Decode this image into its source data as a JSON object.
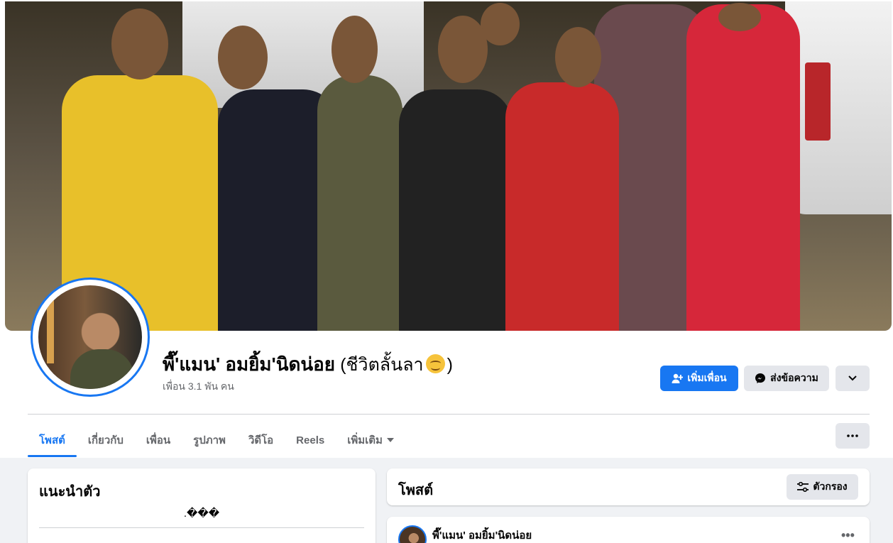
{
  "profile": {
    "name": "พี๊'แมน' อมยิ้ม'นิดน่อย",
    "alt_name_open": "(ชีวิตลั้นลา",
    "alt_name_close": ")",
    "friends": "เพื่อน 3.1 พัน คน"
  },
  "actions": {
    "add_friend": "เพิ่มเพื่อน",
    "message": "ส่งข้อความ"
  },
  "tabs": [
    {
      "label": "โพสต์"
    },
    {
      "label": "เกี่ยวกับ"
    },
    {
      "label": "เพื่อน"
    },
    {
      "label": "รูปภาพ"
    },
    {
      "label": "วิดีโอ"
    },
    {
      "label": "Reels"
    },
    {
      "label": "เพิ่มเติม"
    }
  ],
  "intro": {
    "title": "แนะนำตัว",
    "bio": ".���"
  },
  "posts": {
    "title": "โพสต์",
    "filter": "ตัวกรอง",
    "first_author": "พี๊'แมน' อมยิ้ม'นิดน่อย"
  },
  "colors": {
    "accent": "#1877f2",
    "button_gray": "#e4e6eb",
    "page_bg": "#f0f2f5"
  },
  "icons": [
    "add-friend-icon",
    "messenger-icon",
    "chevron-down-icon",
    "more-icon",
    "filter-icon",
    "smiling-emoji-icon"
  ]
}
